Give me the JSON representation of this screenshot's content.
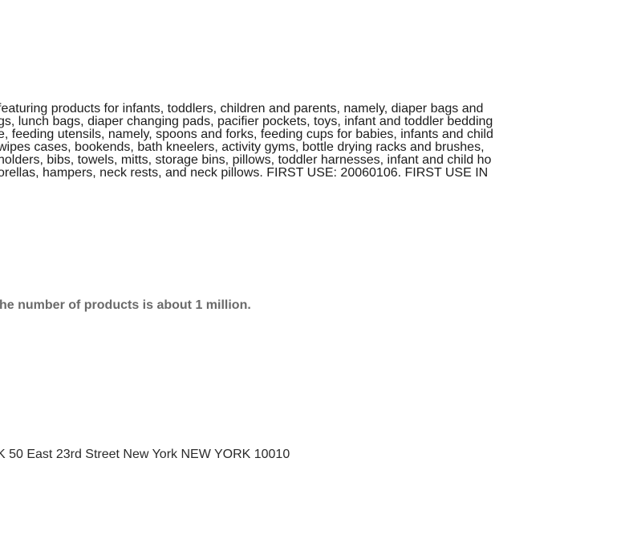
{
  "goods_services": {
    "lines": [
      "featuring products for infants, toddlers, children and parents, namely, diaper bags and",
      "gs, lunch bags, diaper changing pads, pacifier pockets, toys, infant and toddler bedding",
      "e, feeding utensils, namely, spoons and forks, feeding cups for babies, infants and child",
      "wipes cases, bookends, bath kneelers, activity gyms, bottle drying racks and brushes,",
      "holders, bibs, towels, mitts, storage bins, pillows, toddler harnesses, infant and child ho",
      "orellas, hampers, neck rests, and neck pillows. FIRST USE: 20060106. FIRST USE IN"
    ]
  },
  "note": "he number of products is about 1 million.",
  "address": "K 50 East 23rd Street New York NEW YORK 10010"
}
